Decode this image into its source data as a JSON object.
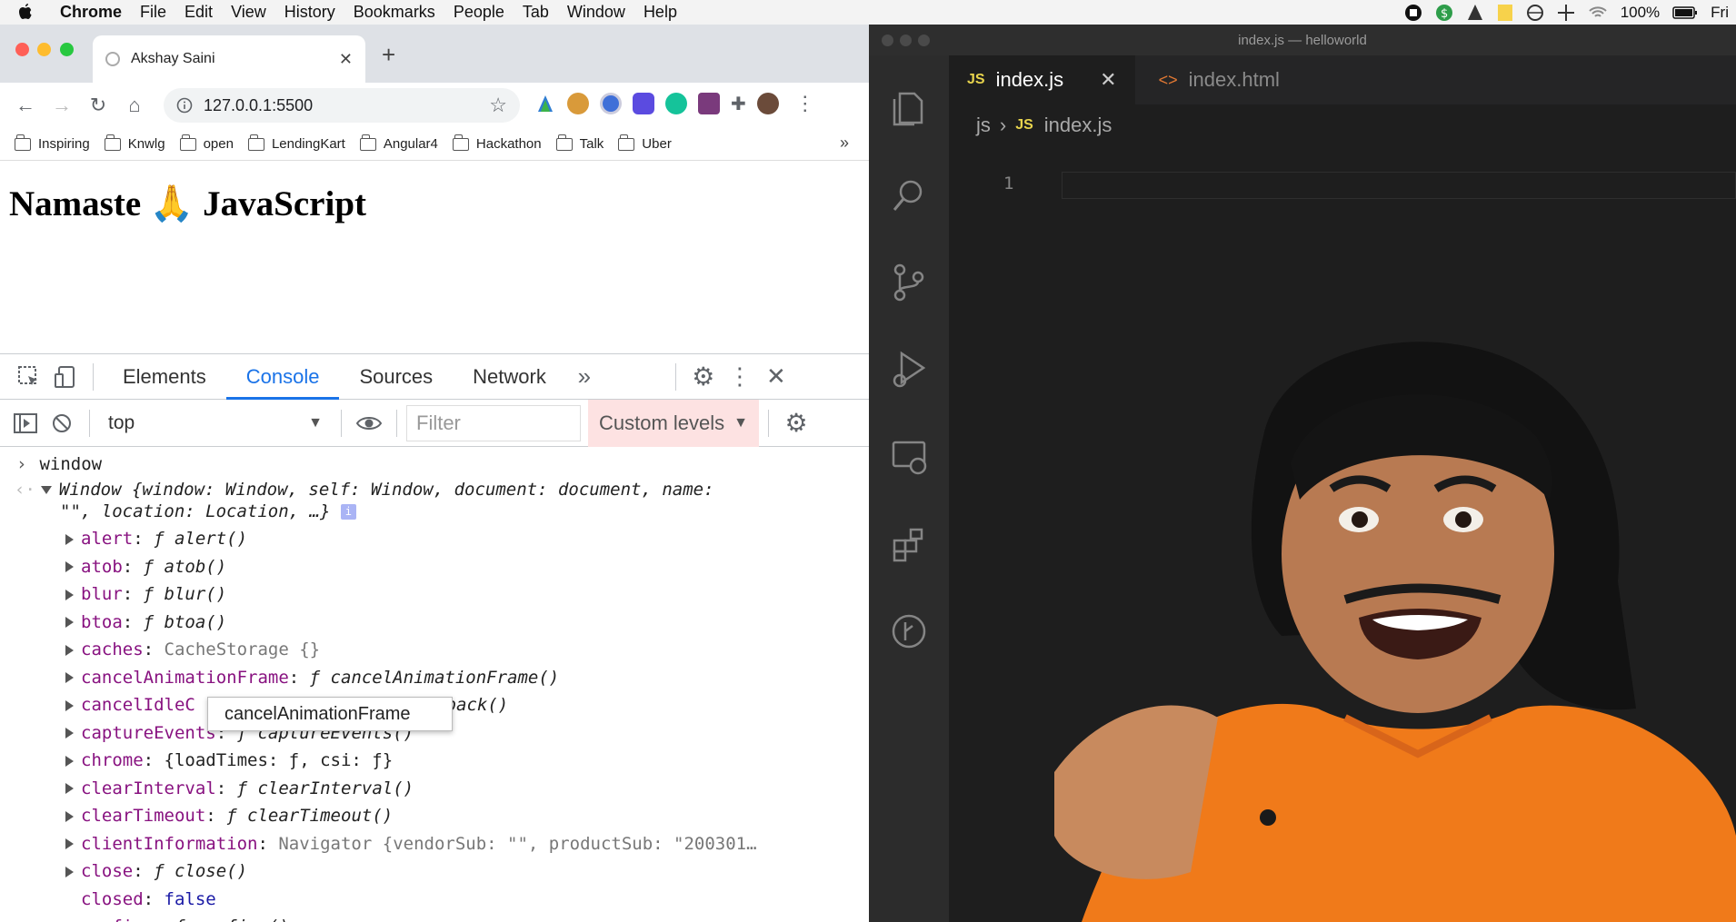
{
  "menubar": {
    "app": "Chrome",
    "items": [
      "File",
      "Edit",
      "View",
      "History",
      "Bookmarks",
      "People",
      "Tab",
      "Window",
      "Help"
    ],
    "battery": "100%",
    "day": "Fri"
  },
  "browser": {
    "tab_title": "Akshay Saini",
    "url": "127.0.0.1:5500",
    "bookmarks": [
      "Inspiring",
      "Knwlg",
      "open",
      "LendingKart",
      "Angular4",
      "Hackathon",
      "Talk",
      "Uber"
    ],
    "page_heading": "Namaste 🙏 JavaScript"
  },
  "devtools": {
    "tabs": [
      "Elements",
      "Console",
      "Sources",
      "Network"
    ],
    "active_tab": "Console",
    "context": "top",
    "filter_placeholder": "Filter",
    "levels": "Custom levels"
  },
  "console": {
    "input": "window",
    "window_summary": {
      "head": "Window {window: Window, self: Window, document: document, name:",
      "tail": "\"\", location: Location, …}"
    },
    "rows": [
      {
        "key": "alert",
        "sep": ": ",
        "f": "ƒ alert()"
      },
      {
        "key": "atob",
        "sep": ": ",
        "f": "ƒ atob()"
      },
      {
        "key": "blur",
        "sep": ": ",
        "f": "ƒ blur()"
      },
      {
        "key": "btoa",
        "sep": ": ",
        "f": "ƒ btoa()"
      },
      {
        "key": "caches",
        "sep": ": ",
        "f": "CacheStorage {}"
      },
      {
        "key": "cancelAnimationFrame",
        "sep": ": ",
        "f": "ƒ cancelAnimationFrame()"
      },
      {
        "key": "cancelIdleC",
        "sep": "",
        "f": "Callback()"
      },
      {
        "key": "captureEvents",
        "sep": ": ",
        "f": "ƒ captureEvents()"
      },
      {
        "key": "chrome",
        "sep": ": ",
        "f": "{loadTimes: ƒ, csi: ƒ}"
      },
      {
        "key": "clearInterval",
        "sep": ": ",
        "f": "ƒ clearInterval()"
      },
      {
        "key": "clearTimeout",
        "sep": ": ",
        "f": "ƒ clearTimeout()"
      },
      {
        "key": "clientInformation",
        "sep": ": ",
        "f": "Navigator {vendorSub: \"\", productSub: \"200301…"
      },
      {
        "key": "close",
        "sep": ": ",
        "f": "ƒ close()"
      },
      {
        "key": "closed",
        "sep": ": ",
        "f": "false"
      },
      {
        "key": "confirm",
        "sep": ": ",
        "f": "ƒ confirm()"
      }
    ],
    "tooltip": "cancelAnimationFrame"
  },
  "vscode": {
    "title": "index.js — helloworld",
    "tabs": [
      "index.js",
      "index.html"
    ],
    "tab_badge": "JS",
    "breadcrumb_folder": "js",
    "breadcrumb_file": "index.js",
    "line_number": "1"
  },
  "colors": {
    "devtools_accent": "#1a73e8",
    "shirt": "#f07a1a",
    "vscode_bg": "#1e1e1e"
  }
}
